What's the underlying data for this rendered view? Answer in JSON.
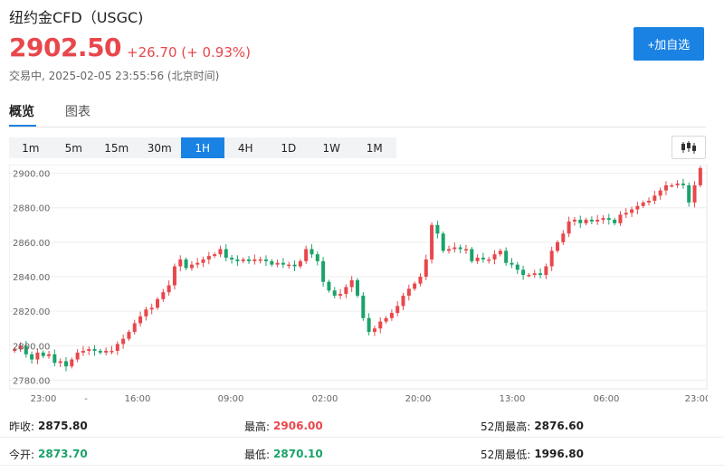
{
  "header": {
    "title": "纽约金CFD（USGC)",
    "price": "2902.50",
    "change": "+26.70 (+ 0.93%)",
    "status": "交易中, 2025-02-05 23:55:56 (北京时间)",
    "add_button": "+加自选"
  },
  "tabs": [
    {
      "label": "概览",
      "active": true
    },
    {
      "label": "图表",
      "active": false
    }
  ],
  "periods": [
    {
      "label": "1m",
      "active": false
    },
    {
      "label": "5m",
      "active": false
    },
    {
      "label": "15m",
      "active": false
    },
    {
      "label": "30m",
      "active": false
    },
    {
      "label": "1H",
      "active": true
    },
    {
      "label": "4H",
      "active": false
    },
    {
      "label": "1D",
      "active": false
    },
    {
      "label": "1W",
      "active": false
    },
    {
      "label": "1M",
      "active": false
    }
  ],
  "colors": {
    "up": "#e8474c",
    "down": "#1aa36a",
    "accent": "#1a82e3"
  },
  "chart_data": {
    "type": "candlestick",
    "yticks": [
      "2900.00",
      "2880.00",
      "2860.00",
      "2840.00",
      "2820.00",
      "2800.00",
      "2780.00"
    ],
    "ylim": [
      2775,
      2905
    ],
    "xticks": [
      "23:00",
      "-",
      "16:00",
      "09:00",
      "02:00",
      "20:00",
      "13:00",
      "06:00",
      "23:00"
    ],
    "grid": true,
    "close": [
      2798,
      2800,
      2795,
      2792,
      2796,
      2794,
      2795,
      2790,
      2791,
      2788,
      2792,
      2796,
      2797,
      2798,
      2797,
      2796,
      2797,
      2797,
      2801,
      2804,
      2808,
      2813,
      2817,
      2821,
      2822,
      2827,
      2831,
      2835,
      2846,
      2850,
      2845,
      2847,
      2848,
      2850,
      2852,
      2853,
      2856,
      2851,
      2850,
      2849,
      2850,
      2849,
      2850,
      2850,
      2849,
      2847,
      2848,
      2847,
      2847,
      2846,
      2849,
      2856,
      2853,
      2849,
      2837,
      2832,
      2829,
      2830,
      2834,
      2838,
      2829,
      2816,
      2808,
      2810,
      2814,
      2816,
      2819,
      2823,
      2829,
      2833,
      2836,
      2840,
      2850,
      2870,
      2865,
      2855,
      2856,
      2857,
      2856,
      2856,
      2849,
      2851,
      2850,
      2850,
      2853,
      2855,
      2848,
      2847,
      2844,
      2841,
      2841,
      2842,
      2841,
      2846,
      2855,
      2860,
      2865,
      2872,
      2873,
      2871,
      2873,
      2872,
      2873,
      2874,
      2873,
      2871,
      2876,
      2877,
      2879,
      2881,
      2883,
      2884,
      2887,
      2890,
      2893,
      2893,
      2894,
      2893,
      2883,
      2893,
      2903
    ]
  }
}
